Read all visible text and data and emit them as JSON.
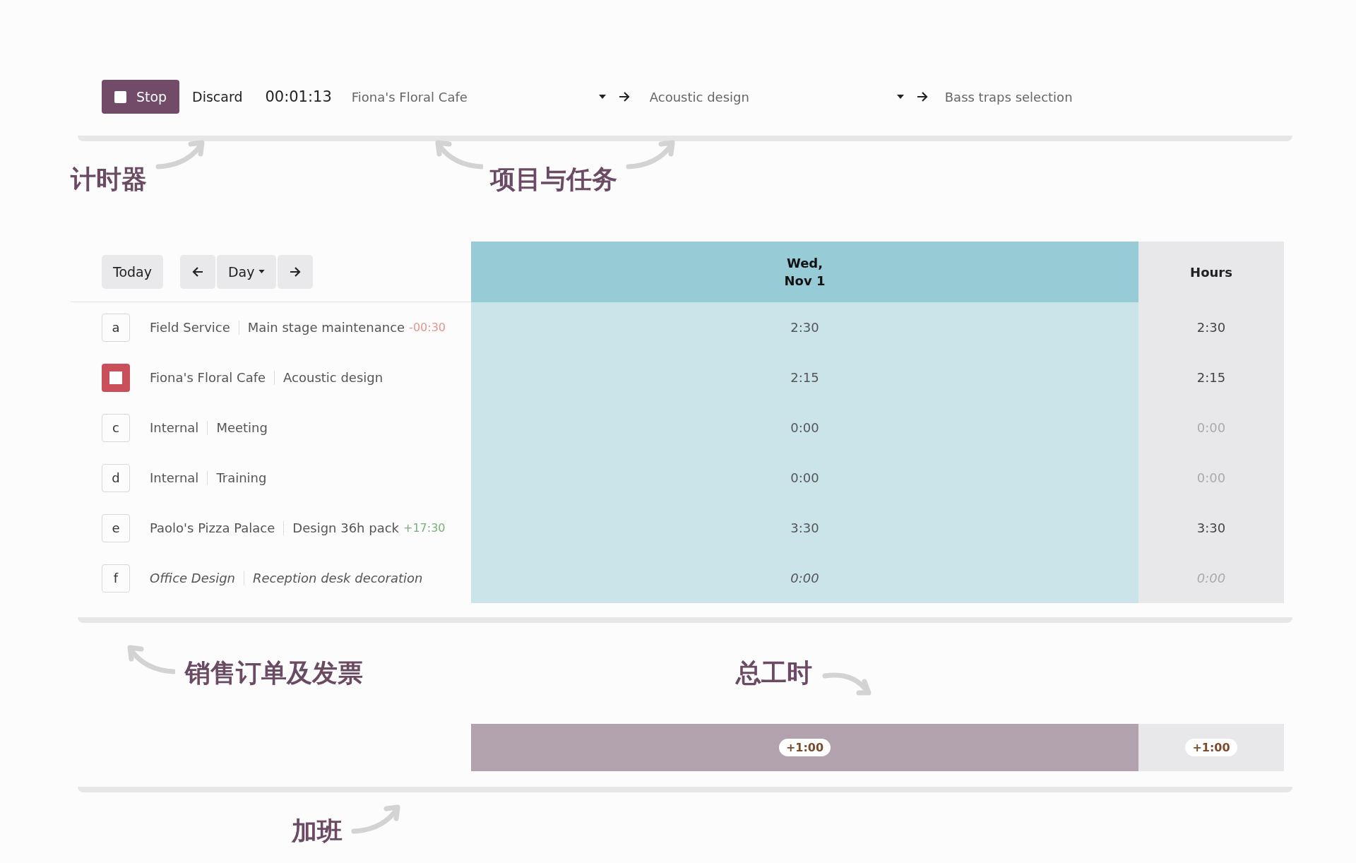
{
  "timer": {
    "stop_label": "Stop",
    "discard_label": "Discard",
    "elapsed": "00:01:13",
    "project": "Fiona's Floral Cafe",
    "task": "Acoustic design",
    "description": "Bass traps selection"
  },
  "annotations": {
    "timer": "计时器",
    "project_task": "项目与任务",
    "sales_orders": "销售订单及发票",
    "total_hours": "总工时",
    "overtime": "加班"
  },
  "grid": {
    "today_label": "Today",
    "scale_label": "Day",
    "day_header": [
      "Wed,",
      "Nov 1"
    ],
    "total_header": "Hours",
    "rows": [
      {
        "key": "a",
        "running": false,
        "project": "Field Service",
        "task": "Main stage maintenance",
        "remaining": {
          "text": "-00:30",
          "color": "#e0958f"
        },
        "italic": false,
        "day": "2:30",
        "total": "2:30",
        "muted": false
      },
      {
        "running": true,
        "project": "Fiona's Floral Cafe",
        "task": "Acoustic design",
        "italic": false,
        "day": "2:15",
        "total": "2:15",
        "muted": false
      },
      {
        "key": "c",
        "running": false,
        "project": "Internal",
        "task": "Meeting",
        "italic": false,
        "day": "0:00",
        "total": "0:00",
        "muted": true
      },
      {
        "key": "d",
        "running": false,
        "project": "Internal",
        "task": "Training",
        "italic": false,
        "day": "0:00",
        "total": "0:00",
        "muted": true
      },
      {
        "key": "e",
        "running": false,
        "project": "Paolo's Pizza Palace",
        "task": "Design 36h pack",
        "remaining": {
          "text": "+17:30",
          "color": "#78b07a"
        },
        "italic": false,
        "day": "3:30",
        "total": "3:30",
        "muted": false
      },
      {
        "key": "f",
        "running": false,
        "project": "Office Design",
        "task": "Reception desk decoration",
        "italic": true,
        "day": "0:00",
        "total": "0:00",
        "muted": true
      }
    ]
  },
  "overtime": {
    "day": "+1:00",
    "total": "+1:00"
  }
}
